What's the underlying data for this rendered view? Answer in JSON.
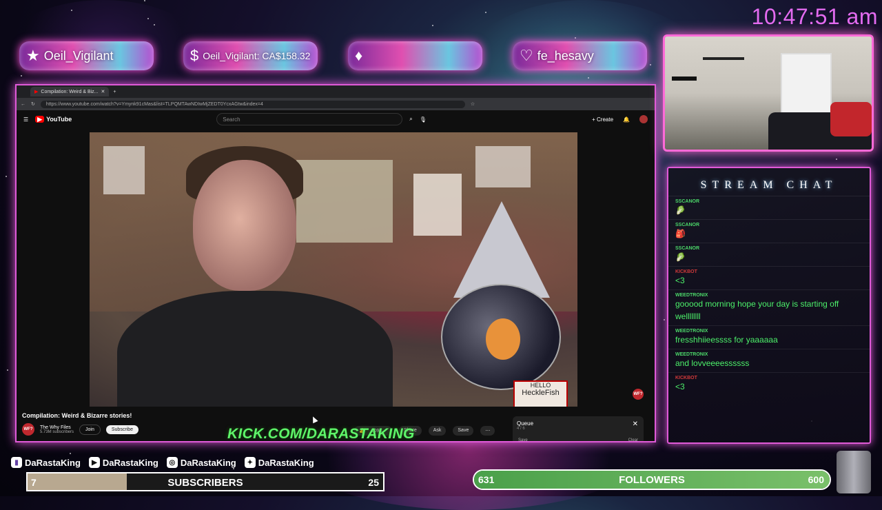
{
  "clock": "10:47:51 am",
  "pills": [
    {
      "icon": "star-icon",
      "glyph": "★",
      "text": "Oeil_Vigilant"
    },
    {
      "icon": "dollar-icon",
      "glyph": "$",
      "text": "Oeil_Vigilant: CA$158.32"
    },
    {
      "icon": "diamond-icon",
      "glyph": "♦",
      "text": ""
    },
    {
      "icon": "heart-icon",
      "glyph": "♡",
      "text": "fe_hesavy"
    }
  ],
  "browser": {
    "tab_title": "Compilation: Weird & Biz...",
    "url": "https://www.youtube.com/watch?v=Ymynk91cMas&list=TLPQMTAwNDIwMjZEDT0YcxAGtw&index=4"
  },
  "youtube": {
    "logo": "YouTube",
    "search_placeholder": "Search",
    "create_label": "Create",
    "video_title": "Compilation: Weird & Bizarre stories!",
    "channel_name": "The Why Files",
    "channel_subs": "5.73M subscribers",
    "join_label": "Join",
    "subscribe_label": "Subscribe",
    "like_count": "109K",
    "share_label": "Share",
    "ask_label": "Ask",
    "save_label": "Save",
    "queue_title": "Queue",
    "queue_count": "4 / 6",
    "queue_save": "Save",
    "queue_clear": "Clear",
    "badge": "WF?",
    "sign_line1": "HELLO",
    "sign_line2": "HeckleFish"
  },
  "kick_url": "KICK.COM/DARASTAKING",
  "chat": {
    "title": "STREAM CHAT",
    "messages": [
      {
        "user": "SSCANOR",
        "text": "🥬",
        "red": false
      },
      {
        "user": "SSCANOR",
        "text": "🎒",
        "red": false
      },
      {
        "user": "SSCANOR",
        "text": "🥬",
        "red": false
      },
      {
        "user": "KICKBOT",
        "text": "<3",
        "red": true
      },
      {
        "user": "WEEDTRONIX",
        "text": "gooood morning hope your day is starting off wellllllll",
        "red": false
      },
      {
        "user": "WEEDTRONIX",
        "text": "fresshhiieessss for yaaaaaa",
        "red": false
      },
      {
        "user": "WEEDTRONIX",
        "text": "and lovveeeessssss",
        "red": false
      },
      {
        "user": "KICKBOT",
        "text": "<3",
        "red": true
      }
    ]
  },
  "socials": [
    {
      "icon": "twitch-icon",
      "glyph": "▮",
      "handle": "DaRastaKing"
    },
    {
      "icon": "youtube-icon",
      "glyph": "▶",
      "handle": "DaRastaKing"
    },
    {
      "icon": "instagram-icon",
      "glyph": "◎",
      "handle": "DaRastaKing"
    },
    {
      "icon": "twitter-icon",
      "glyph": "✦",
      "handle": "DaRastaKing"
    }
  ],
  "subscribers_goal": {
    "label": "SUBSCRIBERS",
    "current": "7",
    "target": "25",
    "progress": 0.28
  },
  "followers_goal": {
    "label": "FOLLOWERS",
    "current": "631",
    "target": "600",
    "progress": 1.0
  },
  "colors": {
    "neon_pink": "#e05ad8",
    "chat_green": "#4cf06a",
    "kick_green": "#5ef56a"
  }
}
